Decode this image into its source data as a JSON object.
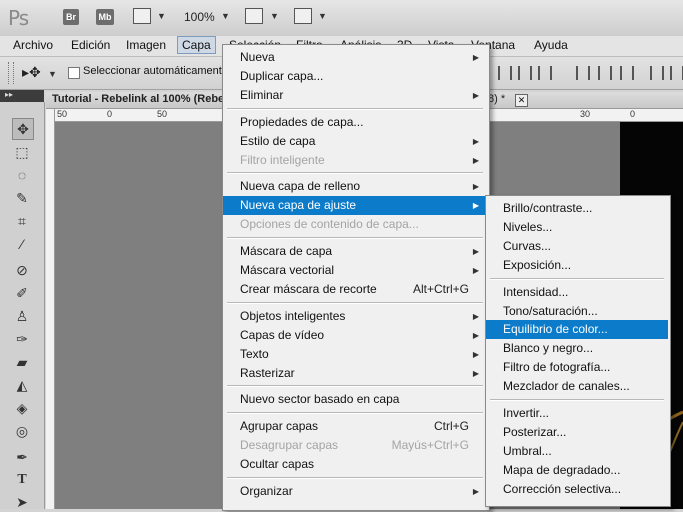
{
  "appbar": {
    "logo": "Ps",
    "bridge_label": "Br",
    "minibridge_label": "Mb",
    "zoom": "100%"
  },
  "menubar": {
    "items": [
      "Archivo",
      "Edición",
      "Imagen",
      "Capa",
      "Selección",
      "Filtro",
      "Análisis",
      "3D",
      "Vista",
      "Ventana",
      "Ayuda"
    ]
  },
  "options": {
    "auto_select_label": "Seleccionar automáticamente:"
  },
  "document": {
    "title": "Tutorial - Rebelink al 100% (Rebe",
    "title_tail": "8) *",
    "close_glyph": "✕",
    "ruler_ticks": [
      "50",
      "0",
      "50",
      "30",
      "0"
    ]
  },
  "capa_menu": {
    "items": [
      {
        "label": "Nueva",
        "arrow": true
      },
      {
        "label": "Duplicar capa..."
      },
      {
        "label": "Eliminar",
        "arrow": true
      },
      {
        "sep": true
      },
      {
        "label": "Propiedades de capa..."
      },
      {
        "label": "Estilo de capa",
        "arrow": true
      },
      {
        "label": "Filtro inteligente",
        "arrow": true,
        "disabled": true
      },
      {
        "sep": true
      },
      {
        "label": "Nueva capa de relleno",
        "arrow": true
      },
      {
        "label": "Nueva capa de ajuste",
        "arrow": true,
        "highlighted": true
      },
      {
        "label": "Opciones de contenido de capa...",
        "disabled": true
      },
      {
        "sep": true
      },
      {
        "label": "Máscara de capa",
        "arrow": true
      },
      {
        "label": "Máscara vectorial",
        "arrow": true
      },
      {
        "label": "Crear máscara de recorte",
        "shortcut": "Alt+Ctrl+G"
      },
      {
        "sep": true
      },
      {
        "label": "Objetos inteligentes",
        "arrow": true
      },
      {
        "label": "Capas de vídeo",
        "arrow": true
      },
      {
        "label": "Texto",
        "arrow": true
      },
      {
        "label": "Rasterizar",
        "arrow": true
      },
      {
        "sep": true
      },
      {
        "label": "Nuevo sector basado en capa"
      },
      {
        "sep": true
      },
      {
        "label": "Agrupar capas",
        "shortcut": "Ctrl+G"
      },
      {
        "label": "Desagrupar capas",
        "shortcut": "Mayús+Ctrl+G",
        "disabled": true
      },
      {
        "label": "Ocultar capas"
      },
      {
        "sep": true
      },
      {
        "label": "Organizar",
        "arrow": true
      }
    ]
  },
  "adjust_submenu": {
    "items": [
      {
        "label": "Brillo/contraste..."
      },
      {
        "label": "Niveles..."
      },
      {
        "label": "Curvas..."
      },
      {
        "label": "Exposición..."
      },
      {
        "sep": true
      },
      {
        "label": "Intensidad..."
      },
      {
        "label": "Tono/saturación..."
      },
      {
        "label": "Equilibrio de color...",
        "highlighted": true
      },
      {
        "label": "Blanco y negro..."
      },
      {
        "label": "Filtro de fotografía..."
      },
      {
        "label": "Mezclador de canales..."
      },
      {
        "sep": true
      },
      {
        "label": "Invertir..."
      },
      {
        "label": "Posterizar..."
      },
      {
        "label": "Umbral..."
      },
      {
        "label": "Mapa de degradado..."
      },
      {
        "label": "Corrección selectiva..."
      }
    ]
  },
  "colors": {
    "highlight": "#0c7bc9",
    "menu_bg": "#f0f0f0",
    "disabled_text": "#a4a4a4"
  }
}
